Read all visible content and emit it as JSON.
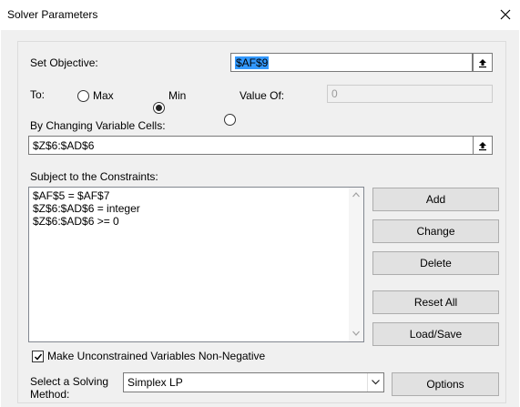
{
  "window": {
    "title": "Solver Parameters",
    "close_glyph": "✕"
  },
  "objective": {
    "label": "Set Objective:",
    "value": "$AF$9"
  },
  "to": {
    "label": "To:",
    "options": [
      {
        "label": "Max",
        "selected": false
      },
      {
        "label": "Min",
        "selected": true
      },
      {
        "label": "Value Of:",
        "selected": false
      }
    ],
    "value_of": "0"
  },
  "changing": {
    "label": "By Changing Variable Cells:",
    "value": "$Z$6:$AD$6"
  },
  "constraints": {
    "label": "Subject to the Constraints:",
    "items": [
      "$AF$5 = $AF$7",
      "$Z$6:$AD$6 = integer",
      "$Z$6:$AD$6 >= 0"
    ]
  },
  "buttons": {
    "add": "Add",
    "change": "Change",
    "delete": "Delete",
    "reset_all": "Reset All",
    "load_save": "Load/Save",
    "options": "Options"
  },
  "nonnegative": {
    "label": "Make Unconstrained Variables Non-Negative",
    "checked": true
  },
  "solving_method": {
    "label_line1": "Select a Solving",
    "label_line2": "Method:",
    "value": "Simplex LP"
  },
  "colors": {
    "dialog_bg": "#f0f0f0",
    "button_bg": "#e1e1e1",
    "border": "#7a7a7a"
  }
}
